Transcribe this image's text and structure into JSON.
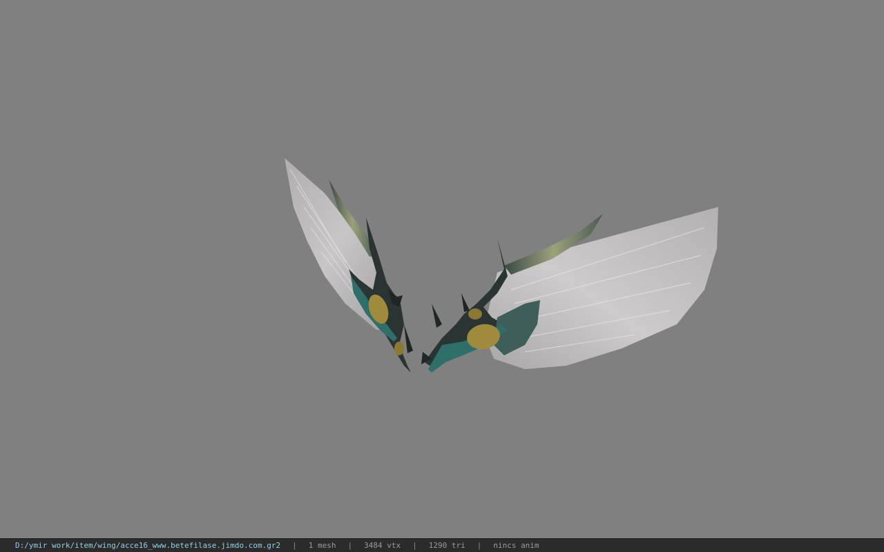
{
  "statusbar": {
    "file_path": "D:/ymir work/item/wing/acce16_www.betefilase.jimdo.com.gr2",
    "separator": "|",
    "mesh_count": "1 mesh",
    "vertex_count": "3484 vtx",
    "triangle_count": "1290 tri",
    "anim_status": "nincs anim"
  },
  "colors": {
    "viewport_background": "#808080",
    "statusbar_background": "#2b2b2b",
    "path_text": "#8fd0e8",
    "stat_text": "#9a9a9a",
    "feather": "#c9c5c7",
    "armor_teal": "#2e6f6a",
    "armor_gold": "#a08a3c",
    "armor_dark": "#2a3433"
  }
}
